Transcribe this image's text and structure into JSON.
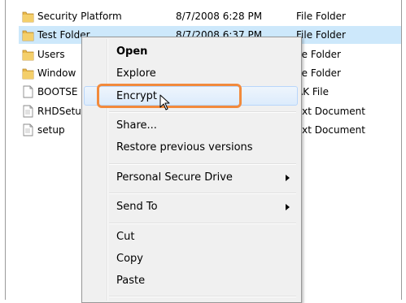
{
  "files": [
    {
      "name": "Security Platform",
      "date": "8/7/2008 6:28 PM",
      "type": "File Folder",
      "icon": "folder-icon",
      "selected": false
    },
    {
      "name": "Test Folder",
      "date": "8/7/2008 6:37 PM",
      "type": "File Folder",
      "icon": "folder-icon",
      "selected": true
    },
    {
      "name": "Users",
      "date": "",
      "type": "ile Folder",
      "icon": "folder-icon",
      "selected": false
    },
    {
      "name": "Window",
      "date": "",
      "type": "ile Folder",
      "icon": "folder-icon",
      "selected": false
    },
    {
      "name": "BOOTSE",
      "date": "",
      "type": "AK File",
      "icon": "document-icon",
      "selected": false
    },
    {
      "name": "RHDSetu",
      "date": "",
      "type": "ext Document",
      "icon": "document-icon",
      "selected": false
    },
    {
      "name": "setup",
      "date": "",
      "type": "ext Document",
      "icon": "document-icon",
      "selected": false
    }
  ],
  "context_menu": {
    "items": [
      {
        "label": "Open",
        "bold": true
      },
      {
        "label": "Explore"
      },
      {
        "label": "Encrypt",
        "highlighted": true
      },
      {
        "label": "Share..."
      },
      {
        "label": "Restore previous versions"
      },
      {
        "label": "Personal Secure Drive",
        "submenu": true
      },
      {
        "label": "Send To",
        "submenu": true
      },
      {
        "label": "Cut"
      },
      {
        "label": "Copy"
      },
      {
        "label": "Paste"
      }
    ]
  },
  "colors": {
    "selection": "#cde8fb",
    "callout": "#f28a3c",
    "menu_background": "#f0f0f0",
    "folder": "#e8b84a"
  }
}
